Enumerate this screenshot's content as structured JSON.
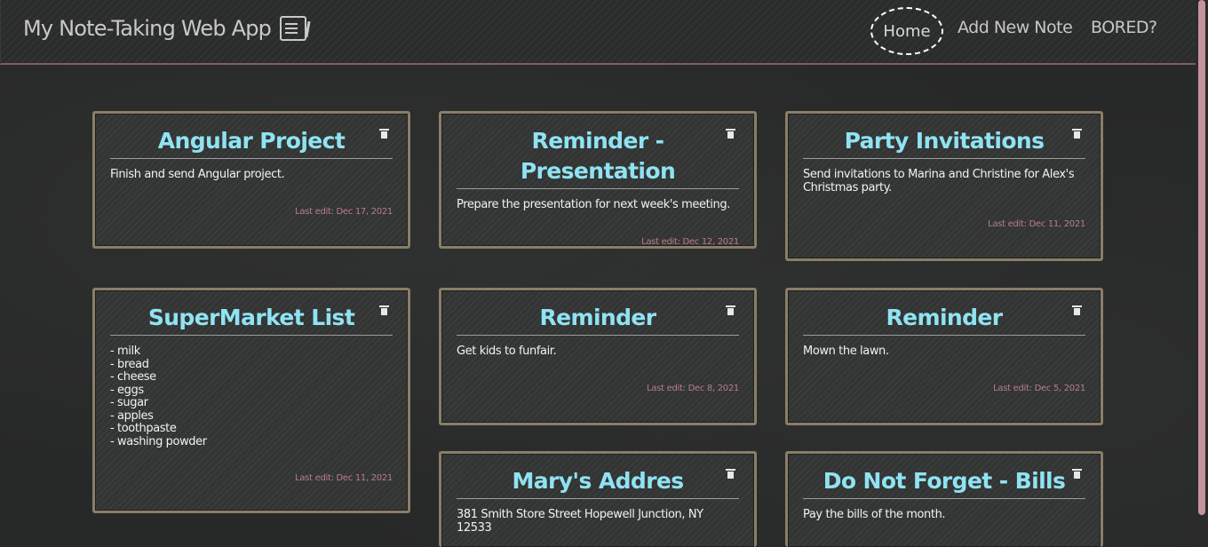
{
  "app": {
    "title": "My Note-Taking Web App",
    "icon": "notepad-icon"
  },
  "nav": {
    "home": "Home",
    "add_new_note": "Add New Note",
    "bored": "BORED?"
  },
  "colors": {
    "background": "#272828",
    "title_accent": "#8fe3f2",
    "edit_text": "#b87e8a",
    "card_border": "#8a7e67",
    "navbar_border": "#7d5e66"
  },
  "notes": [
    {
      "title": "Angular Project",
      "body": "Finish and send Angular project.",
      "edited": "Last edit: Dec 17, 2021"
    },
    {
      "title": "Reminder - Presentation",
      "body": "Prepare the presentation for next week's meeting.",
      "edited": "Last edit: Dec 12, 2021"
    },
    {
      "title": "Party Invitations",
      "body": "Send invitations to Marina and Christine for Alex's Christmas party.",
      "edited": "Last edit: Dec 11, 2021"
    },
    {
      "title": "SuperMarket List",
      "body": "- milk\n- bread\n- cheese\n- eggs\n- sugar\n- apples\n- toothpaste\n- washing powder",
      "edited": "Last edit: Dec 11, 2021"
    },
    {
      "title": "Reminder",
      "body": "Get kids to funfair.",
      "edited": "Last edit: Dec 8, 2021"
    },
    {
      "title": "Reminder",
      "body": "Mown the lawn.",
      "edited": "Last edit: Dec 5, 2021"
    },
    {
      "title": "Mary's Addres",
      "body": "381 Smith Store Street Hopewell Junction, NY 12533",
      "edited": ""
    },
    {
      "title": "Do Not Forget - Bills",
      "body": "Pay the bills of the month.",
      "edited": ""
    }
  ]
}
